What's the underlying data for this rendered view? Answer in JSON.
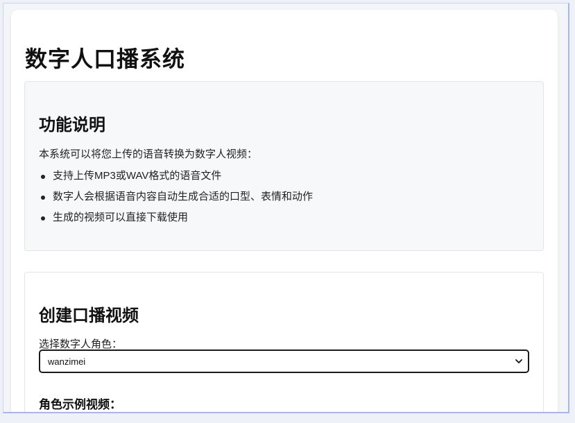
{
  "page": {
    "title": "数字人口播系统"
  },
  "info": {
    "title": "功能说明",
    "description": "本系统可以将您上传的语音转换为数字人视频：",
    "features": [
      "支持上传MP3或WAV格式的语音文件",
      "数字人会根据语音内容自动生成合适的口型、表情和动作",
      "生成的视频可以直接下载使用"
    ]
  },
  "create": {
    "title": "创建口播视频",
    "role_label": "选择数字人角色：",
    "role_selected": "wanzimei",
    "sample_label": "角色示例视频："
  },
  "icons": {
    "select_arrow": "chevron-down-icon"
  }
}
